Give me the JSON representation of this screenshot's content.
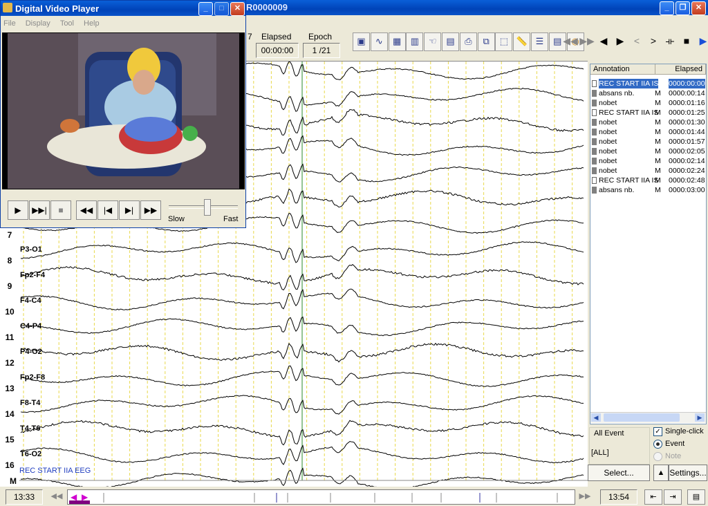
{
  "main_window": {
    "title": "R0000009"
  },
  "toolbar": {
    "field_cut": "7",
    "elapsed_label": "Elapsed",
    "elapsed_value": "00:00:00",
    "epoch_label": "Epoch",
    "epoch_value": "1 /21",
    "tool_icons": [
      "save-icon",
      "waveform-icon",
      "montage-icon",
      "channel-icon",
      "hand-icon",
      "notes-icon",
      "print-icon",
      "copy-icon",
      "select-icon",
      "ruler-icon",
      "list-icon",
      "report-icon",
      "globe-icon"
    ],
    "nav_buttons": [
      "◀◀",
      "▶▶",
      "◀",
      "▶",
      "<",
      ">",
      "⟛",
      "■",
      "▶"
    ]
  },
  "video_player": {
    "title": "Digital Video Player",
    "menu": [
      "File",
      "Display",
      "Tool",
      "Help"
    ],
    "speed_slow": "Slow",
    "speed_fast": "Fast",
    "speed_value": 0.55
  },
  "eeg": {
    "channels": [
      {
        "num": "7",
        "name": "P3-O1"
      },
      {
        "num": "8",
        "name": "Fp2-F4"
      },
      {
        "num": "9",
        "name": "F4-C4"
      },
      {
        "num": "10",
        "name": "C4-P4"
      },
      {
        "num": "11",
        "name": "P4-O2"
      },
      {
        "num": "12",
        "name": "Fp2-F8"
      },
      {
        "num": "13",
        "name": "F8-T4"
      },
      {
        "num": "14",
        "name": "T4-T6"
      },
      {
        "num": "15",
        "name": "T6-O2"
      },
      {
        "num": "16",
        "name": ""
      }
    ],
    "marker_label": "REC START IIA EEG",
    "m_label": "M"
  },
  "annotations": {
    "col_annotation": "Annotation",
    "col_elapsed": "Elapsed",
    "rows": [
      {
        "label": "REC START IIA IS",
        "type": "",
        "time": "0000:00:00",
        "white": true,
        "selected": true
      },
      {
        "label": "absans nb.",
        "type": "M",
        "time": "0000:00:14",
        "white": false
      },
      {
        "label": "nobet",
        "type": "M",
        "time": "0000:01:16",
        "white": false
      },
      {
        "label": "REC START IIA IS",
        "type": "M",
        "time": "0000:01:25",
        "white": true
      },
      {
        "label": "nobet",
        "type": "M",
        "time": "0000:01:30",
        "white": false
      },
      {
        "label": "nobet",
        "type": "M",
        "time": "0000:01:44",
        "white": false
      },
      {
        "label": "nobet",
        "type": "M",
        "time": "0000:01:57",
        "white": false
      },
      {
        "label": "nobet",
        "type": "M",
        "time": "0000:02:05",
        "white": false
      },
      {
        "label": "nobet",
        "type": "M",
        "time": "0000:02:14",
        "white": false
      },
      {
        "label": "nobet",
        "type": "M",
        "time": "0000:02:24",
        "white": false
      },
      {
        "label": "REC START IIA IS",
        "type": "M",
        "time": "0000:02:48",
        "white": true
      },
      {
        "label": "absans nb.",
        "type": "M",
        "time": "0000:03:00",
        "white": false
      }
    ],
    "all_event": "All Event",
    "all_value": "[ALL]",
    "single_click": "Single-click",
    "event": "Event",
    "note": "Note",
    "select_btn": "Select...",
    "settings_btn": "Settings..."
  },
  "timeline": {
    "start": "13:33",
    "end": "13:54"
  }
}
